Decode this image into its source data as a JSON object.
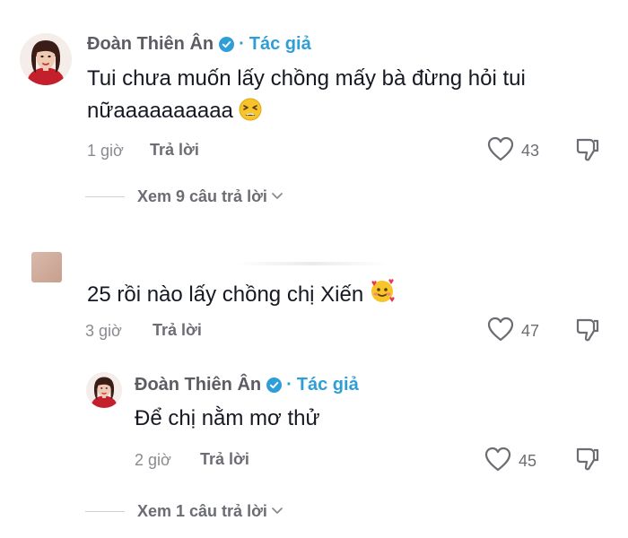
{
  "colors": {
    "author_tag": "#2f9ed8",
    "verified_badge": "#2f9ed8",
    "text": "#161823",
    "meta": "#8a8b91"
  },
  "comments": [
    {
      "author": "Đoàn Thiên Ân",
      "author_tag": "Tác giả",
      "separator": "·",
      "text_line1": "Tui chưa muốn lấy chồng mấy bà đừng hỏi tui",
      "text_line2": "nữaaaaaaaaaa",
      "emoji": "tired-face-emoji",
      "time": "1 giờ",
      "reply_label": "Trả lời",
      "likes": "43",
      "view_replies": "Xem 9 câu trả lời"
    },
    {
      "author": "",
      "text": "25 rồi nào lấy chồng chị Xiến",
      "emoji": "smiling-face-with-hearts-emoji",
      "time": "3 giờ",
      "reply_label": "Trả lời",
      "likes": "47",
      "replies": [
        {
          "author": "Đoàn Thiên Ân",
          "author_tag": "Tác giả",
          "separator": "·",
          "text": "Để chị nằm mơ thử",
          "time": "2 giờ",
          "reply_label": "Trả lời",
          "likes": "45"
        }
      ],
      "view_replies": "Xem 1 câu trả lời"
    }
  ]
}
